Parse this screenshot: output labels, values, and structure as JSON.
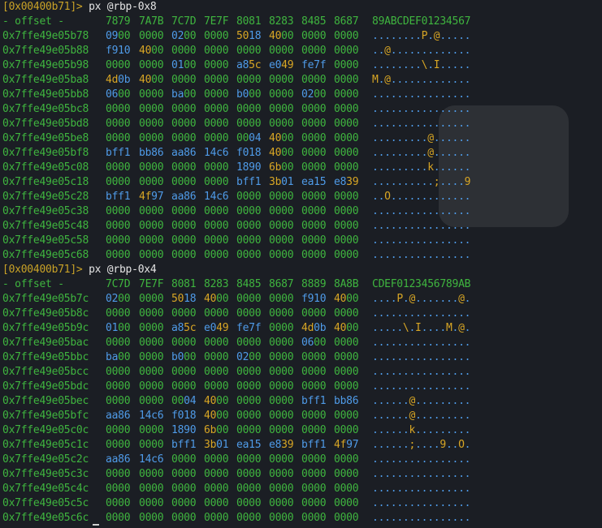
{
  "blocks": [
    {
      "prompt": {
        "addr": "[0x00400b71]>",
        "cmd": "px @rbp-0x8"
      },
      "header": {
        "offset": "- offset -",
        "cols": [
          "7879",
          "7A7B",
          "7C7D",
          "7E7F",
          "8081",
          "8283",
          "8485",
          "8687"
        ],
        "ascii": "89ABCDEF01234567"
      },
      "rows": [
        {
          "addr": "0x7ffe49e05b78",
          "words": [
            "0900",
            "0000",
            "0200",
            "0000",
            "5018",
            "4000",
            "0000",
            "0000"
          ],
          "ascii": "........P.@....."
        },
        {
          "addr": "0x7ffe49e05b88",
          "words": [
            "f910",
            "4000",
            "0000",
            "0000",
            "0000",
            "0000",
            "0000",
            "0000"
          ],
          "ascii": "..@............."
        },
        {
          "addr": "0x7ffe49e05b98",
          "words": [
            "0000",
            "0000",
            "0100",
            "0000",
            "a85c",
            "e049",
            "fe7f",
            "0000"
          ],
          "ascii": "........\\.I....."
        },
        {
          "addr": "0x7ffe49e05ba8",
          "words": [
            "4d0b",
            "4000",
            "0000",
            "0000",
            "0000",
            "0000",
            "0000",
            "0000"
          ],
          "ascii": "M.@............."
        },
        {
          "addr": "0x7ffe49e05bb8",
          "words": [
            "0600",
            "0000",
            "ba00",
            "0000",
            "b000",
            "0000",
            "0200",
            "0000"
          ],
          "ascii": "................"
        },
        {
          "addr": "0x7ffe49e05bc8",
          "words": [
            "0000",
            "0000",
            "0000",
            "0000",
            "0000",
            "0000",
            "0000",
            "0000"
          ],
          "ascii": "................"
        },
        {
          "addr": "0x7ffe49e05bd8",
          "words": [
            "0000",
            "0000",
            "0000",
            "0000",
            "0000",
            "0000",
            "0000",
            "0000"
          ],
          "ascii": "................"
        },
        {
          "addr": "0x7ffe49e05be8",
          "words": [
            "0000",
            "0000",
            "0000",
            "0000",
            "0004",
            "4000",
            "0000",
            "0000"
          ],
          "ascii": ".........@......"
        },
        {
          "addr": "0x7ffe49e05bf8",
          "words": [
            "bff1",
            "bb86",
            "aa86",
            "14c6",
            "f018",
            "4000",
            "0000",
            "0000"
          ],
          "ascii": ".........@......"
        },
        {
          "addr": "0x7ffe49e05c08",
          "words": [
            "0000",
            "0000",
            "0000",
            "0000",
            "1890",
            "6b00",
            "0000",
            "0000"
          ],
          "ascii": ".........k......"
        },
        {
          "addr": "0x7ffe49e05c18",
          "words": [
            "0000",
            "0000",
            "0000",
            "0000",
            "bff1",
            "3b01",
            "ea15",
            "e839"
          ],
          "ascii": "..........;....9"
        },
        {
          "addr": "0x7ffe49e05c28",
          "words": [
            "bff1",
            "4f97",
            "aa86",
            "14c6",
            "0000",
            "0000",
            "0000",
            "0000"
          ],
          "ascii": "..O............."
        },
        {
          "addr": "0x7ffe49e05c38",
          "words": [
            "0000",
            "0000",
            "0000",
            "0000",
            "0000",
            "0000",
            "0000",
            "0000"
          ],
          "ascii": "................"
        },
        {
          "addr": "0x7ffe49e05c48",
          "words": [
            "0000",
            "0000",
            "0000",
            "0000",
            "0000",
            "0000",
            "0000",
            "0000"
          ],
          "ascii": "................"
        },
        {
          "addr": "0x7ffe49e05c58",
          "words": [
            "0000",
            "0000",
            "0000",
            "0000",
            "0000",
            "0000",
            "0000",
            "0000"
          ],
          "ascii": "................"
        },
        {
          "addr": "0x7ffe49e05c68",
          "words": [
            "0000",
            "0000",
            "0000",
            "0000",
            "0000",
            "0000",
            "0000",
            "0000"
          ],
          "ascii": "................"
        }
      ]
    },
    {
      "prompt": {
        "addr": "[0x00400b71]>",
        "cmd": "px @rbp-0x4"
      },
      "header": {
        "offset": "- offset -",
        "cols": [
          "7C7D",
          "7E7F",
          "8081",
          "8283",
          "8485",
          "8687",
          "8889",
          "8A8B"
        ],
        "ascii": "CDEF0123456789AB"
      },
      "rows": [
        {
          "addr": "0x7ffe49e05b7c",
          "words": [
            "0200",
            "0000",
            "5018",
            "4000",
            "0000",
            "0000",
            "f910",
            "4000"
          ],
          "ascii": "....P.@.......@."
        },
        {
          "addr": "0x7ffe49e05b8c",
          "words": [
            "0000",
            "0000",
            "0000",
            "0000",
            "0000",
            "0000",
            "0000",
            "0000"
          ],
          "ascii": "................"
        },
        {
          "addr": "0x7ffe49e05b9c",
          "words": [
            "0100",
            "0000",
            "a85c",
            "e049",
            "fe7f",
            "0000",
            "4d0b",
            "4000"
          ],
          "ascii": ".....\\.I....M.@."
        },
        {
          "addr": "0x7ffe49e05bac",
          "words": [
            "0000",
            "0000",
            "0000",
            "0000",
            "0000",
            "0000",
            "0600",
            "0000"
          ],
          "ascii": "................"
        },
        {
          "addr": "0x7ffe49e05bbc",
          "words": [
            "ba00",
            "0000",
            "b000",
            "0000",
            "0200",
            "0000",
            "0000",
            "0000"
          ],
          "ascii": "................"
        },
        {
          "addr": "0x7ffe49e05bcc",
          "words": [
            "0000",
            "0000",
            "0000",
            "0000",
            "0000",
            "0000",
            "0000",
            "0000"
          ],
          "ascii": "................"
        },
        {
          "addr": "0x7ffe49e05bdc",
          "words": [
            "0000",
            "0000",
            "0000",
            "0000",
            "0000",
            "0000",
            "0000",
            "0000"
          ],
          "ascii": "................"
        },
        {
          "addr": "0x7ffe49e05bec",
          "words": [
            "0000",
            "0000",
            "0004",
            "4000",
            "0000",
            "0000",
            "bff1",
            "bb86"
          ],
          "ascii": "......@........."
        },
        {
          "addr": "0x7ffe49e05bfc",
          "words": [
            "aa86",
            "14c6",
            "f018",
            "4000",
            "0000",
            "0000",
            "0000",
            "0000"
          ],
          "ascii": "......@........."
        },
        {
          "addr": "0x7ffe49e05c0c",
          "words": [
            "0000",
            "0000",
            "1890",
            "6b00",
            "0000",
            "0000",
            "0000",
            "0000"
          ],
          "ascii": "......k........."
        },
        {
          "addr": "0x7ffe49e05c1c",
          "words": [
            "0000",
            "0000",
            "bff1",
            "3b01",
            "ea15",
            "e839",
            "bff1",
            "4f97"
          ],
          "ascii": "......;....9..O."
        },
        {
          "addr": "0x7ffe49e05c2c",
          "words": [
            "aa86",
            "14c6",
            "0000",
            "0000",
            "0000",
            "0000",
            "0000",
            "0000"
          ],
          "ascii": "................"
        },
        {
          "addr": "0x7ffe49e05c3c",
          "words": [
            "0000",
            "0000",
            "0000",
            "0000",
            "0000",
            "0000",
            "0000",
            "0000"
          ],
          "ascii": "................"
        },
        {
          "addr": "0x7ffe49e05c4c",
          "words": [
            "0000",
            "0000",
            "0000",
            "0000",
            "0000",
            "0000",
            "0000",
            "0000"
          ],
          "ascii": "................"
        },
        {
          "addr": "0x7ffe49e05c5c",
          "words": [
            "0000",
            "0000",
            "0000",
            "0000",
            "0000",
            "0000",
            "0000",
            "0000"
          ],
          "ascii": "................"
        },
        {
          "addr": "0x7ffe49e05c6c",
          "words": [
            "0000",
            "0000",
            "0000",
            "0000",
            "0000",
            "0000",
            "0000",
            "0000"
          ],
          "ascii": "................"
        }
      ]
    }
  ],
  "colors": {
    "background": "#1b1e24",
    "prompt_address": "#c9a227",
    "offset_green": "#3fb53f",
    "byte_blue": "#4f9be8",
    "byte_yellow": "#d8a624",
    "command_text": "#e4e4e4"
  }
}
